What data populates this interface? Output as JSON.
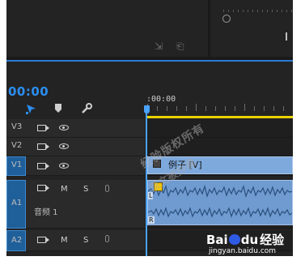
{
  "timeline": {
    "timecode": "00:00",
    "ruler_start": ":00:00"
  },
  "tracks": {
    "v3": {
      "label": "V3"
    },
    "v2": {
      "label": "V2"
    },
    "v1": {
      "label": "V1"
    },
    "a1": {
      "label": "A1",
      "name": "音频 1",
      "mute": "M",
      "solo": "S"
    },
    "a2": {
      "label": "A2",
      "mute": "M",
      "solo": "S"
    }
  },
  "clips": {
    "video_clip_label": "例子 [V]",
    "audio_left_channel": "L",
    "audio_right_channel": "R"
  },
  "watermark": {
    "line1": "经验版权所有",
    "line2": "原文被抄袭",
    "brand_a": "Bai",
    "brand_b": "du",
    "brand_suffix": "经验",
    "url": "jingyan.baidu.com"
  },
  "colors": {
    "timecode": "#2b8ef0",
    "playhead": "#4aa3ff",
    "work_area": "#e8d200",
    "video_clip": "#7ea9dc",
    "audio_clip": "#6f9bd0"
  }
}
